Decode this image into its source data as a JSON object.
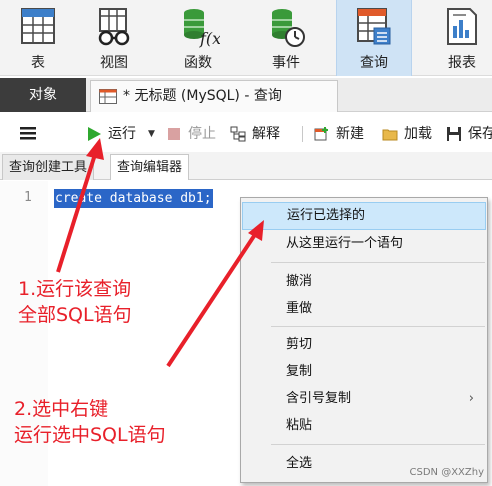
{
  "ribbon": {
    "items": [
      {
        "label": "表",
        "icon": "table-icon"
      },
      {
        "label": "视图",
        "icon": "view-icon"
      },
      {
        "label": "函数",
        "icon": "function-icon"
      },
      {
        "label": "事件",
        "icon": "event-icon"
      },
      {
        "label": "查询",
        "icon": "query-icon",
        "active": true
      },
      {
        "label": "报表",
        "icon": "report-icon"
      }
    ]
  },
  "tabs": {
    "objects": "对象",
    "query_tab": "* 无标题 (MySQL) - 查询"
  },
  "toolbar": {
    "run": "运行",
    "stop": "停止",
    "explain": "解释",
    "new": "新建",
    "load": "加载",
    "save": "保存"
  },
  "subtabs": {
    "builder": "查询创建工具",
    "editor": "查询编辑器"
  },
  "editor": {
    "line_number": "1",
    "code": "create database db1;"
  },
  "context_menu": {
    "items": [
      "运行已选择的",
      "从这里运行一个语句",
      "撤消",
      "重做",
      "剪切",
      "复制",
      "含引号复制",
      "粘贴",
      "全选"
    ],
    "submenu_chevron": "›"
  },
  "annotations": {
    "note1_line1": "1.运行该查询",
    "note1_line2": "全部SQL语句",
    "note2_line1": "2.选中右键",
    "note2_line2": "运行选中SQL语句",
    "color": "#e8202a"
  },
  "watermark": "CSDN @XXZhy"
}
